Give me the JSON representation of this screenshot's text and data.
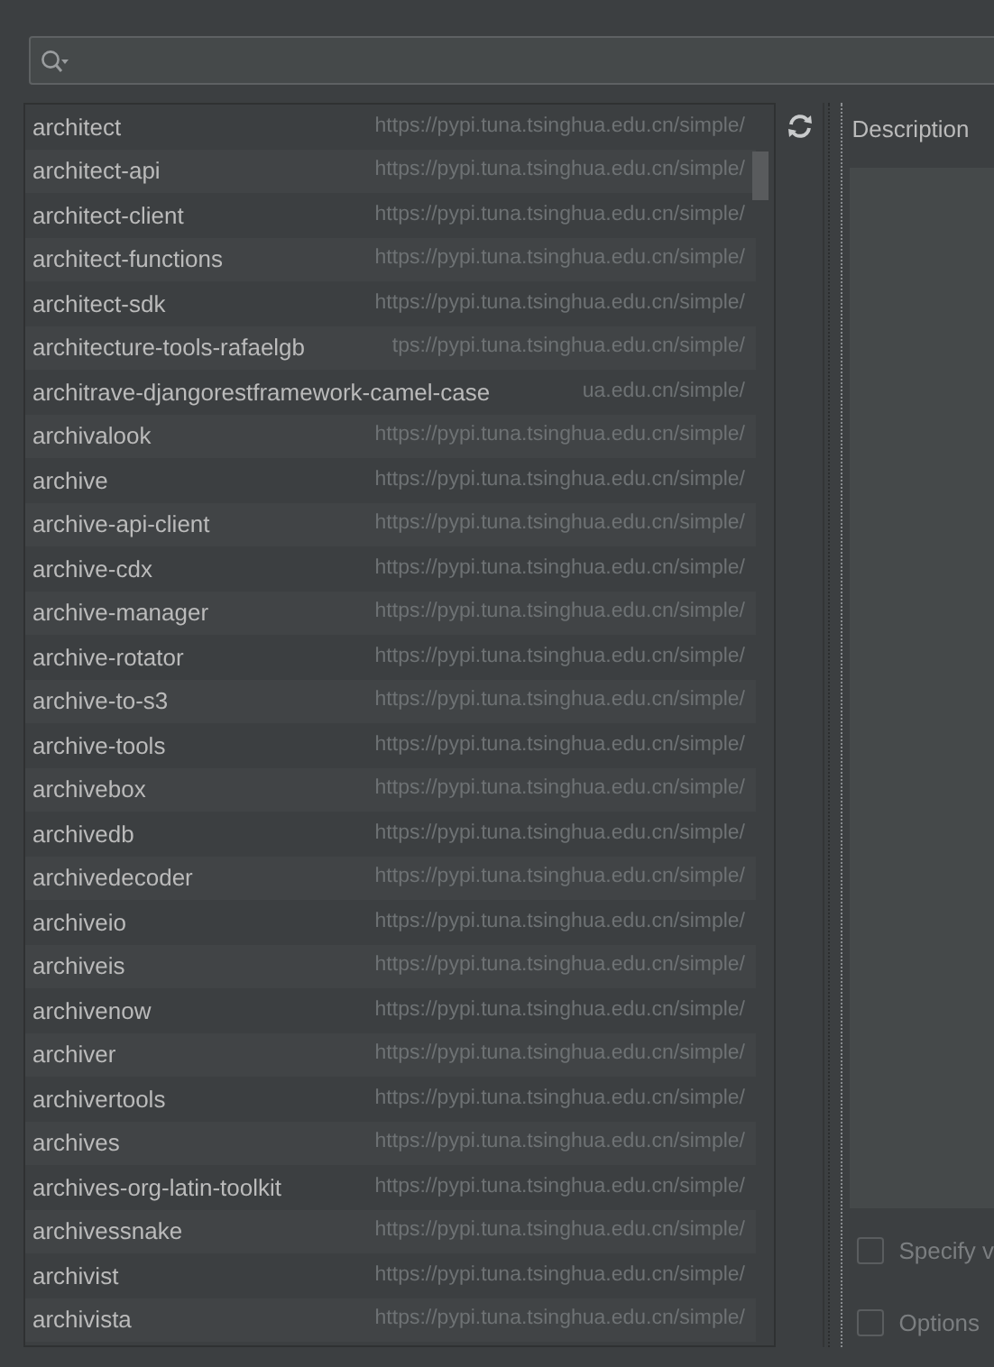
{
  "packages": [
    {
      "name": "architect",
      "repository": "https://pypi.tuna.tsinghua.edu.cn/simple/"
    },
    {
      "name": "architect-api",
      "repository": "https://pypi.tuna.tsinghua.edu.cn/simple/"
    },
    {
      "name": "architect-client",
      "repository": "https://pypi.tuna.tsinghua.edu.cn/simple/"
    },
    {
      "name": "architect-functions",
      "repository": "https://pypi.tuna.tsinghua.edu.cn/simple/"
    },
    {
      "name": "architect-sdk",
      "repository": "https://pypi.tuna.tsinghua.edu.cn/simple/"
    },
    {
      "name": "architecture-tools-rafaelgb",
      "repository": "tps://pypi.tuna.tsinghua.edu.cn/simple/"
    },
    {
      "name": "architrave-djangorestframework-camel-case",
      "repository": "ua.edu.cn/simple/"
    },
    {
      "name": "archivalook",
      "repository": "https://pypi.tuna.tsinghua.edu.cn/simple/"
    },
    {
      "name": "archive",
      "repository": "https://pypi.tuna.tsinghua.edu.cn/simple/"
    },
    {
      "name": "archive-api-client",
      "repository": "https://pypi.tuna.tsinghua.edu.cn/simple/"
    },
    {
      "name": "archive-cdx",
      "repository": "https://pypi.tuna.tsinghua.edu.cn/simple/"
    },
    {
      "name": "archive-manager",
      "repository": "https://pypi.tuna.tsinghua.edu.cn/simple/"
    },
    {
      "name": "archive-rotator",
      "repository": "https://pypi.tuna.tsinghua.edu.cn/simple/"
    },
    {
      "name": "archive-to-s3",
      "repository": "https://pypi.tuna.tsinghua.edu.cn/simple/"
    },
    {
      "name": "archive-tools",
      "repository": "https://pypi.tuna.tsinghua.edu.cn/simple/"
    },
    {
      "name": "archivebox",
      "repository": "https://pypi.tuna.tsinghua.edu.cn/simple/"
    },
    {
      "name": "archivedb",
      "repository": "https://pypi.tuna.tsinghua.edu.cn/simple/"
    },
    {
      "name": "archivedecoder",
      "repository": "https://pypi.tuna.tsinghua.edu.cn/simple/"
    },
    {
      "name": "archiveio",
      "repository": "https://pypi.tuna.tsinghua.edu.cn/simple/"
    },
    {
      "name": "archiveis",
      "repository": "https://pypi.tuna.tsinghua.edu.cn/simple/"
    },
    {
      "name": "archivenow",
      "repository": "https://pypi.tuna.tsinghua.edu.cn/simple/"
    },
    {
      "name": "archiver",
      "repository": "https://pypi.tuna.tsinghua.edu.cn/simple/"
    },
    {
      "name": "archivertools",
      "repository": "https://pypi.tuna.tsinghua.edu.cn/simple/"
    },
    {
      "name": "archives",
      "repository": "https://pypi.tuna.tsinghua.edu.cn/simple/"
    },
    {
      "name": "archives-org-latin-toolkit",
      "repository": "https://pypi.tuna.tsinghua.edu.cn/simple/"
    },
    {
      "name": "archivessnake",
      "repository": "https://pypi.tuna.tsinghua.edu.cn/simple/"
    },
    {
      "name": "archivist",
      "repository": "https://pypi.tuna.tsinghua.edu.cn/simple/"
    },
    {
      "name": "archivista",
      "repository": "https://pypi.tuna.tsinghua.edu.cn/simple/"
    }
  ],
  "details": {
    "title": "Description",
    "options": [
      {
        "label": "Specify v",
        "checked": false
      },
      {
        "label": "Options",
        "checked": false
      }
    ]
  }
}
